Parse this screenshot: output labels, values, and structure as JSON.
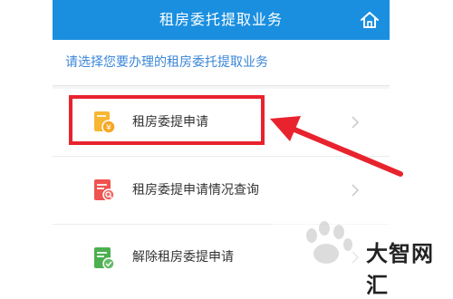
{
  "header": {
    "title": "租房委托提取业务",
    "home_icon": "home-icon"
  },
  "prompt": "请选择您要办理的租房委托提取业务",
  "menu": [
    {
      "label": "租房委提申请",
      "icon": "document-coin-icon",
      "icon_color": "#f5a623"
    },
    {
      "label": "租房委提申请情况查询",
      "icon": "document-search-icon",
      "icon_color": "#ef5350"
    },
    {
      "label": "解除租房委提申请",
      "icon": "document-check-icon",
      "icon_color": "#4caf50"
    }
  ],
  "watermark": {
    "text": "大智网汇"
  },
  "colors": {
    "header": "#1a8fe0",
    "prompt": "#3a86d8",
    "highlight": "#e8232d"
  }
}
